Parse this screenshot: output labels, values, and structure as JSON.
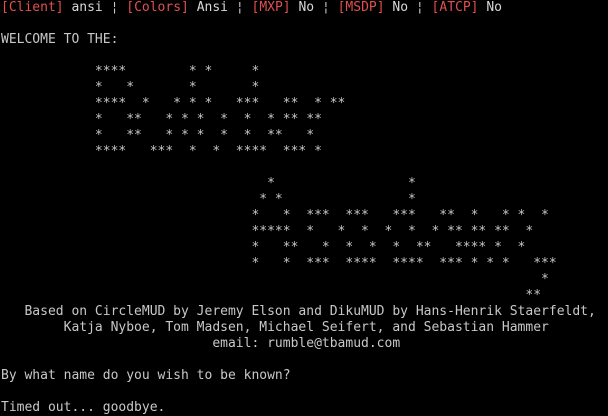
{
  "status_bar": {
    "client_tag": "[Client]",
    "client_value": " ansi ",
    "colors_tag": "[Colors]",
    "colors_value": " Ansi ",
    "mxp_tag": "[MXP]",
    "mxp_value": " No ",
    "msdp_tag": "[MSDP]",
    "msdp_value": " No ",
    "atcp_tag": "[ATCP]",
    "atcp_value": " No",
    "separator": "¦ "
  },
  "welcome": "WELCOME TO THE:",
  "banner": [
    "            ****        * *     *",
    "            *   *       *       *",
    "            ****  *   * * *   ***   **  * **",
    "            *   **   * * *  *  *  * ** **",
    "            *   **   * * *  *  *  **   *",
    "            ****   ***  *  *  ****  *** *",
    "",
    "                                  *                 *",
    "                                 * *                *",
    "                                *   *  ***  ***   ***   **  *   * *  *",
    "                                *****  *   *  *  *  *  * ** ** **  *",
    "                                *   **   *  *  *  *  **   **** *  *",
    "                                *   *  ***  ****  ****  *** * * *   ***",
    "                                                                     *",
    "                                                                   **"
  ],
  "credits": [
    "   Based on CircleMUD by Jeremy Elson and DikuMUD by Hans-Henrik Staerfeldt,",
    "        Katja Nyboe, Tom Madsen, Michael Seifert, and Sebastian Hammer",
    "                           email: rumble@tbamud.com"
  ],
  "prompt": "By what name do you wish to be known?",
  "timeout": "Timed out... goodbye."
}
